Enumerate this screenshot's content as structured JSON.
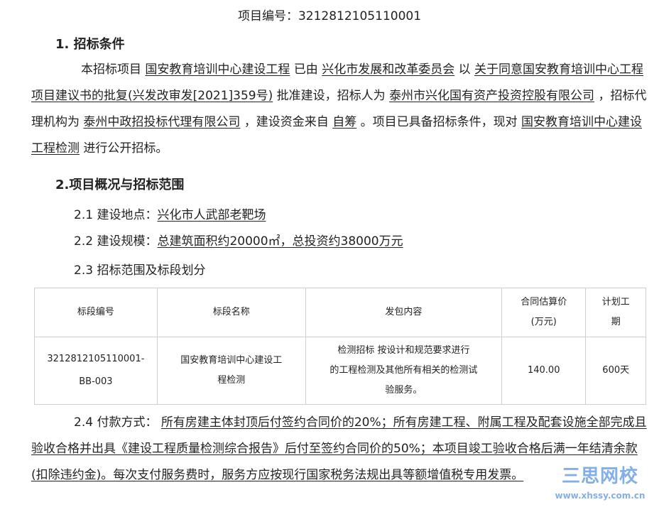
{
  "header": {
    "project_no": "项目编号：3212812105110001"
  },
  "section1": {
    "title": "1. 招标条件",
    "p_intro": "本招标项目",
    "project_name": "国安教育培训中心建设工程",
    "t_approved_by": "已由",
    "approver": "兴化市发展和改革委员会",
    "t_by": "以",
    "approval_doc": "关于同意国安教育培训中心工程项目建议书的批复(兴发改审发[2021]359号)",
    "t_approved_tenderer": "批准建设，招标人为",
    "tenderer": "泰州市兴化国有资产投资控股有限公司",
    "t_agent": "，招标代理机构为",
    "agent": "泰州中政招投标代理有限公司",
    "t_fund": "，建设资金来自",
    "fund": "自筹",
    "t_ready": "。项目已具备招标条件，现对",
    "bid_project": "国安教育培训中心建设工程检测",
    "t_end": "进行公开招标。"
  },
  "section2": {
    "title": "2.项目概况与招标范围",
    "loc_label": "2.1 建设地点：",
    "loc_value": "兴化市人武部老靶场",
    "scale_label": "2.2 建设规模：",
    "scale_value": "总建筑面积约20000㎡，总投资约38000万元",
    "scope_label": "2.3 招标范围及标段划分",
    "table": {
      "headers": [
        "标段编号",
        "标段名称",
        "发包内容",
        "合同估算价\n(万元)",
        "计划工\n期"
      ],
      "rows": [
        [
          "3212812105110001-\nBB-003",
          "国安教育培训中心建设工\n程检测",
          "检测招标 按设计和规范要求进行\n的工程检测及其他所有相关的检测试\n验服务。",
          "140.00",
          "600天"
        ]
      ]
    },
    "pay_label": "2.4 付款方式：",
    "pay_value": "所有房建主体封顶后付签约合同价的20%；所有房建工程、附属工程及配套设施全部完成且验收合格并出具《建设工程质量检测综合报告》后付至签约合同价的50%；本项目竣工验收合格后满一年结清余款(扣除违约金)。每次支付服务费时，服务方应按现行国家税务法规出具等额增值税专用发票。"
  },
  "watermark": {
    "logo": "三思网校",
    "url": "www.xhssy.com.cn"
  },
  "colors": {
    "text": "#222222",
    "table_border": "#cfcfcf",
    "watermark": "#1f6fd6"
  }
}
